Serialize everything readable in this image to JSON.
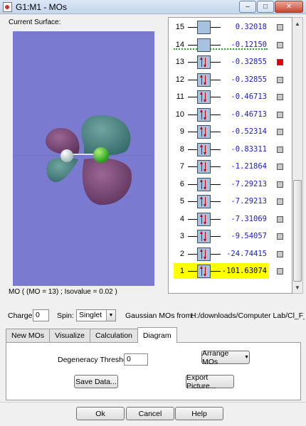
{
  "window": {
    "title": "G1:M1 - MOs",
    "controls": {
      "minimize": "–",
      "maximize": "□",
      "close": "✕"
    }
  },
  "left_panel": {
    "current_surface_label": "Current Surface:",
    "mo_info": "MO ( (MO = 13) ; Isovalue = 0.02 )",
    "viewport_background": "#7a7bd0"
  },
  "mo_diagram": {
    "orbitals": [
      {
        "index": "15",
        "energy": "0.32018",
        "occupied": false,
        "selected": false,
        "visible": false
      },
      {
        "index": "14",
        "energy": "-0.12150",
        "occupied": false,
        "selected": false,
        "visible": false
      },
      {
        "index": "13",
        "energy": "-0.32855",
        "occupied": true,
        "selected": false,
        "visible": true
      },
      {
        "index": "12",
        "energy": "-0.32855",
        "occupied": true,
        "selected": false,
        "visible": false
      },
      {
        "index": "11",
        "energy": "-0.46713",
        "occupied": true,
        "selected": false,
        "visible": false
      },
      {
        "index": "10",
        "energy": "-0.46713",
        "occupied": true,
        "selected": false,
        "visible": false
      },
      {
        "index": "9",
        "energy": "-0.52314",
        "occupied": true,
        "selected": false,
        "visible": false
      },
      {
        "index": "8",
        "energy": "-0.83311",
        "occupied": true,
        "selected": false,
        "visible": false
      },
      {
        "index": "7",
        "energy": "-1.21864",
        "occupied": true,
        "selected": false,
        "visible": false
      },
      {
        "index": "6",
        "energy": "-7.29213",
        "occupied": true,
        "selected": false,
        "visible": false
      },
      {
        "index": "5",
        "energy": "-7.29213",
        "occupied": true,
        "selected": false,
        "visible": false
      },
      {
        "index": "4",
        "energy": "-7.31069",
        "occupied": true,
        "selected": false,
        "visible": false
      },
      {
        "index": "3",
        "energy": "-9.54057",
        "occupied": true,
        "selected": false,
        "visible": false
      },
      {
        "index": "2",
        "energy": "-24.74415",
        "occupied": true,
        "selected": false,
        "visible": false
      },
      {
        "index": "1",
        "energy": "-101.63074",
        "occupied": true,
        "selected": true,
        "visible": false
      }
    ],
    "colors": {
      "energy_text": "#1a1ad0",
      "highlight": "#ffff00",
      "homo_lumo_line": "#22aa22",
      "visible_checkbox": "#e00000"
    }
  },
  "controls": {
    "charge_label": "Charge:",
    "charge_value": "0",
    "spin_label": "Spin:",
    "spin_value": "Singlet",
    "gaussian_label": "Gaussian MOs from:",
    "gaussian_path": "H:/downloads/Computer Lab/Cl_F_F"
  },
  "tabs": [
    {
      "label": "New MOs",
      "active": false
    },
    {
      "label": "Visualize",
      "active": false
    },
    {
      "label": "Calculation",
      "active": false
    },
    {
      "label": "Diagram",
      "active": true
    }
  ],
  "diagram_tab": {
    "degeneracy_label": "Degeneracy Threshold:",
    "degeneracy_value": "0",
    "arrange_button": "Arrange MOs",
    "save_button": "Save Data...",
    "export_button": "Export Picture..."
  },
  "footer": {
    "ok": "Ok",
    "cancel": "Cancel",
    "help": "Help"
  }
}
